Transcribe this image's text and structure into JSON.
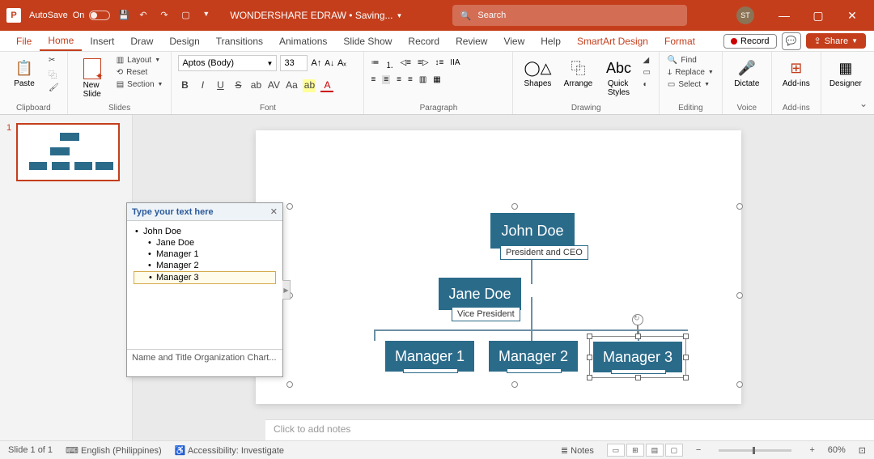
{
  "titlebar": {
    "autosave_label": "AutoSave",
    "autosave_state": "On",
    "doc_title": "WONDERSHARE EDRAW • Saving...",
    "search_placeholder": "Search",
    "user_initials": "ST"
  },
  "tabs": {
    "file": "File",
    "home": "Home",
    "insert": "Insert",
    "draw": "Draw",
    "design": "Design",
    "transitions": "Transitions",
    "animations": "Animations",
    "slideshow": "Slide Show",
    "record_tab": "Record",
    "review": "Review",
    "view": "View",
    "help": "Help",
    "smartart": "SmartArt Design",
    "format": "Format",
    "record_btn": "Record",
    "share": "Share"
  },
  "ribbon": {
    "clipboard": {
      "paste": "Paste",
      "label": "Clipboard"
    },
    "slides": {
      "new_slide": "New\nSlide",
      "layout": "Layout",
      "reset": "Reset",
      "section": "Section",
      "label": "Slides"
    },
    "font": {
      "name": "Aptos (Body)",
      "size": "33",
      "label": "Font"
    },
    "paragraph": {
      "label": "Paragraph"
    },
    "drawing": {
      "shapes": "Shapes",
      "arrange": "Arrange",
      "quick_styles": "Quick\nStyles",
      "label": "Drawing"
    },
    "editing": {
      "find": "Find",
      "replace": "Replace",
      "select": "Select",
      "label": "Editing"
    },
    "voice": {
      "dictate": "Dictate",
      "label": "Voice"
    },
    "addins": {
      "addins": "Add-ins",
      "label": "Add-ins"
    },
    "designer": {
      "designer": "Designer"
    }
  },
  "thumbnail": {
    "number": "1"
  },
  "textpane": {
    "header": "Type your text here",
    "footer": "Name and Title Organization Chart...",
    "items": {
      "l1": "John Doe",
      "l2": "Jane Doe",
      "l3": "Manager 1",
      "l4": "Manager 2",
      "l5_editing": "Manager 3"
    }
  },
  "org": {
    "ceo_name": "John Doe",
    "ceo_title": "President and CEO",
    "vp_name": "Jane Doe",
    "vp_title": "Vice President",
    "mgr1": "Manager 1",
    "mgr2": "Manager 2",
    "mgr3": "Manager 3"
  },
  "notes": {
    "placeholder": "Click to add notes"
  },
  "status": {
    "slide": "Slide 1 of 1",
    "lang": "English (Philippines)",
    "accessibility": "Accessibility: Investigate",
    "notes": "Notes",
    "zoom": "60%"
  }
}
